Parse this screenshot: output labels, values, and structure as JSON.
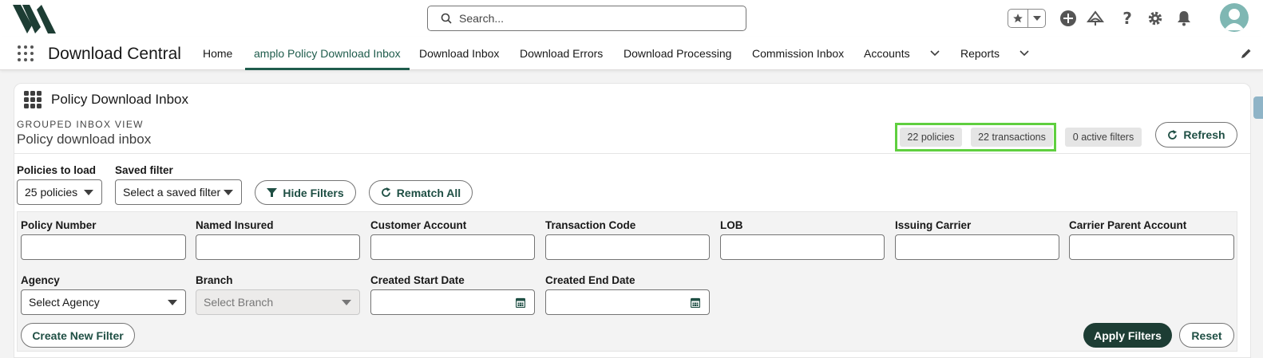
{
  "header": {
    "search_placeholder": "Search...",
    "icons": [
      "search-icon",
      "star-icon",
      "chevron-down-icon",
      "plus-icon",
      "trailhead-icon",
      "help-icon",
      "gear-icon",
      "bell-icon",
      "avatar-icon"
    ]
  },
  "nav": {
    "app_name": "Download Central",
    "tabs": [
      {
        "label": "Home"
      },
      {
        "label": "amplo Policy Download Inbox",
        "active": true
      },
      {
        "label": "Download Inbox"
      },
      {
        "label": "Download Errors"
      },
      {
        "label": "Download Processing"
      },
      {
        "label": "Commission Inbox"
      },
      {
        "label": "Accounts"
      },
      {
        "label": "Reports"
      }
    ]
  },
  "card": {
    "title": "Policy Download Inbox",
    "eyebrow": "GROUPED INBOX VIEW",
    "subtitle": "Policy download inbox",
    "stats": {
      "policies": "22 policies",
      "transactions": "22 transactions",
      "active_filters": "0 active filters"
    },
    "refresh_label": "Refresh"
  },
  "controls": {
    "policies_to_load_label": "Policies to load",
    "policies_to_load_value": "25 policies",
    "saved_filter_label": "Saved filter",
    "saved_filter_placeholder": "Select a saved filter",
    "hide_filters_label": "Hide Filters",
    "rematch_all_label": "Rematch All"
  },
  "filters": {
    "policy_number": "Policy Number",
    "named_insured": "Named Insured",
    "customer_account": "Customer Account",
    "transaction_code": "Transaction Code",
    "lob": "LOB",
    "issuing_carrier": "Issuing Carrier",
    "carrier_parent_account": "Carrier Parent Account",
    "agency": "Agency",
    "agency_placeholder": "Select Agency",
    "branch": "Branch",
    "branch_placeholder": "Select Branch",
    "created_start_date": "Created Start Date",
    "created_end_date": "Created End Date",
    "create_new_filter_label": "Create New Filter",
    "apply_filters_label": "Apply Filters",
    "reset_label": "Reset"
  },
  "colors": {
    "accent": "#1f5c4c",
    "primary_button": "#1d3d34",
    "highlight": "#5fcf3f"
  }
}
